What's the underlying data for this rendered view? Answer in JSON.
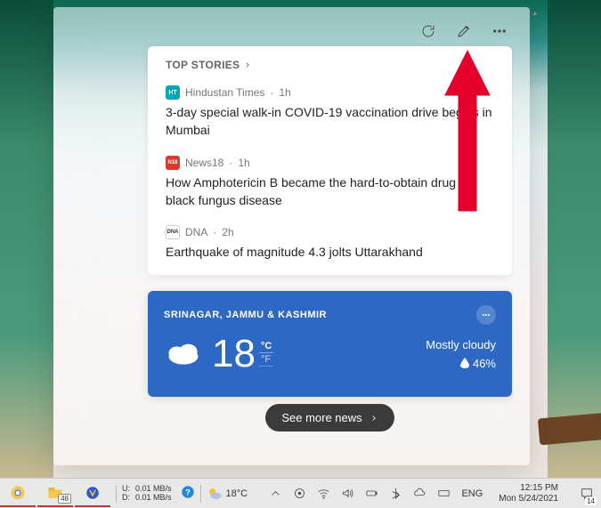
{
  "toolbar": {
    "refresh_name": "refresh",
    "edit_name": "edit",
    "more_name": "more"
  },
  "top_stories": {
    "header": "TOP STORIES",
    "stories": [
      {
        "source": "Hindustan Times",
        "time": "1h",
        "src_icon_text": "HT",
        "src_icon_bg": "#00a8b5",
        "headline": "3-day special walk-in COVID-19 vaccination drive begins in Mumbai"
      },
      {
        "source": "News18",
        "time": "1h",
        "src_icon_text": "N18",
        "src_icon_bg": "#d93a2b",
        "headline": "How Amphotericin B became the hard-to-obtain drug for black fungus disease"
      },
      {
        "source": "DNA",
        "time": "2h",
        "src_icon_text": "DNA",
        "src_icon_bg": "#333333",
        "headline": "Earthquake of magnitude 4.3 jolts Uttarakhand"
      }
    ]
  },
  "weather": {
    "location": "SRINAGAR, JAMMU & KASHMIR",
    "temp": "18",
    "unit_c": "°C",
    "unit_f": "°F",
    "condition": "Mostly cloudy",
    "humidity": "46%"
  },
  "see_more_label": "See more news",
  "taskbar": {
    "chrome_badge": "48",
    "net_up_label": "U:",
    "net_dn_label": "D:",
    "net_up": "0.01 MB/s",
    "net_dn": "0.01 MB/s",
    "weather_temp": "18°C",
    "lang": "ENG",
    "time": "12:15 PM",
    "date": "Mon 5/24/2021",
    "notif_count": "14"
  }
}
